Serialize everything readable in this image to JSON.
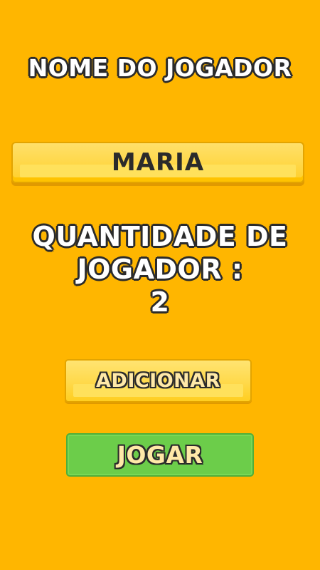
{
  "screen": {
    "title": "NOME DO JOGADOR",
    "name_field_value": "MARIA",
    "player_count_label": "QUANTIDADE DE JOGADOR :",
    "player_count": "2"
  },
  "buttons": {
    "add_label": "ADICIONAR",
    "play_label": "JOGAR"
  },
  "colors": {
    "background": "#FFB600",
    "field": "#FFD84A",
    "add_button": "#FFD94A",
    "play_button": "#6CCD4A",
    "outline": "#2B2B2B"
  }
}
